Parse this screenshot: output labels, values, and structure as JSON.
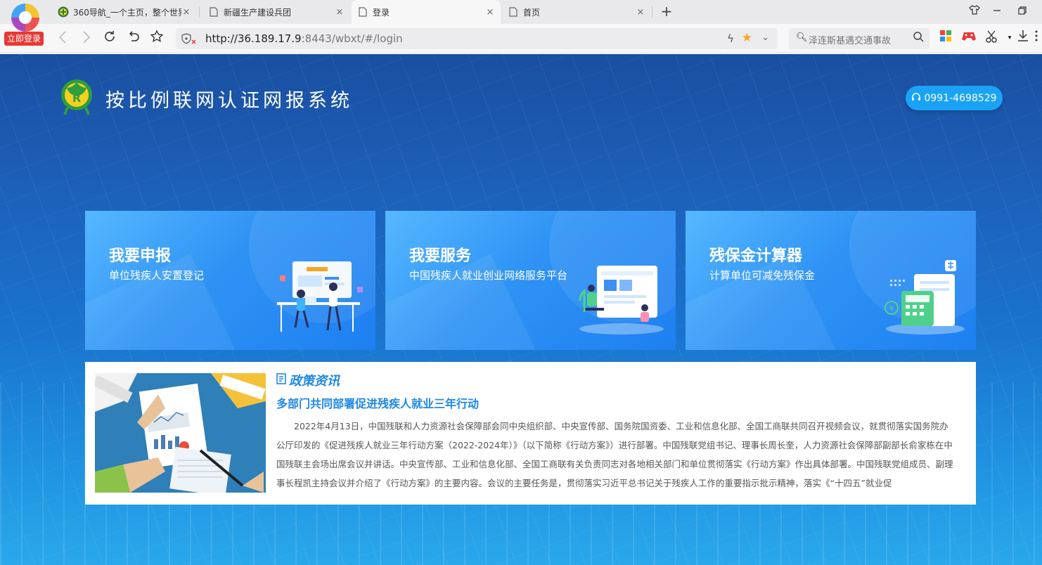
{
  "browser": {
    "login_badge": "立即登录",
    "tabs": [
      {
        "title": "360导航_一个主页，整个世界",
        "close": "×",
        "active": false
      },
      {
        "title": "新疆生产建设兵团",
        "close": "×",
        "active": false
      },
      {
        "title": "登录",
        "close": "×",
        "active": true
      },
      {
        "title": "首页",
        "close": "×",
        "active": false
      }
    ],
    "new_tab": "+",
    "url_host": "http://36.189.17.9",
    "url_path": ":8443/wbxt/#/login",
    "search_query": "泽连斯基遇交通事故",
    "accent": "#f5a623"
  },
  "site": {
    "title": "按比例联网认证网报系统",
    "phone": "0991-4698529"
  },
  "cards": [
    {
      "title": "我要申报",
      "subtitle": "单位残疾人安置登记"
    },
    {
      "title": "我要服务",
      "subtitle": "中国残疾人就业创业网络服务平台"
    },
    {
      "title": "残保金计算器",
      "subtitle": "计算单位可减免残保金"
    }
  ],
  "news": {
    "section": "政策资讯",
    "headline": "多部门共同部署促进残疾人就业三年行动",
    "body": "2022年4月13日，中国残联和人力资源社会保障部会同中央组织部、中央宣传部、国务院国资委、工业和信息化部、全国工商联共同召开视频会议，就贯彻落实国务院办公厅印发的《促进残疾人就业三年行动方案（2022-2024年）》（以下简称《行动方案》）进行部署。中国残联党组书记、理事长周长奎，人力资源社会保障部副部长俞家栋在中国残联主会场出席会议并讲话。中央宣传部、工业和信息化部、全国工商联有关负责同志对各地相关部门和单位贯彻落实《行动方案》作出具体部署。中国残联党组成员、副理事长程凯主持会议并介绍了《行动方案》的主要内容。会议的主要任务是，贯彻落实习近平总书记关于残疾人工作的重要指示批示精神，落实《“十四五”就业促"
  }
}
